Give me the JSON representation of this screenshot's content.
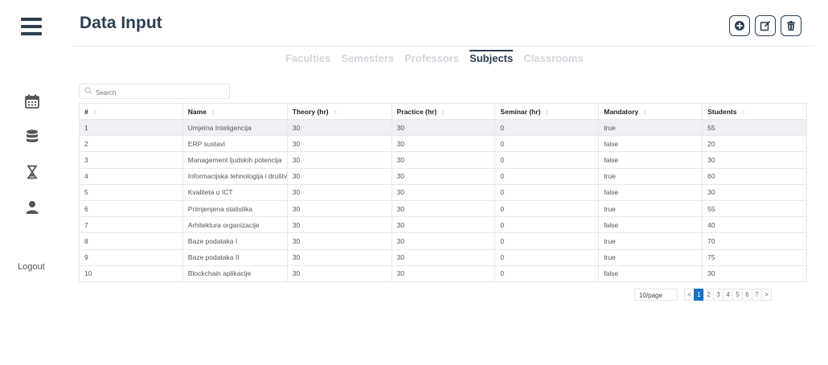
{
  "page": {
    "title": "Data Input"
  },
  "sidebar": {
    "items": [
      {
        "icon": "calendar-icon"
      },
      {
        "icon": "database-icon"
      },
      {
        "icon": "hourglass-icon"
      },
      {
        "icon": "user-icon"
      }
    ],
    "logout_label": "Logout"
  },
  "actions": [
    "add-icon",
    "edit-icon",
    "delete-icon"
  ],
  "tabs": [
    {
      "label": "Faculties",
      "active": false
    },
    {
      "label": "Semesters",
      "active": false
    },
    {
      "label": "Professors",
      "active": false
    },
    {
      "label": "Subjects",
      "active": true
    },
    {
      "label": "Classrooms",
      "active": false
    }
  ],
  "search": {
    "placeholder": "Search"
  },
  "table": {
    "columns": [
      "#",
      "Name",
      "Theory (hr)",
      "Practice (hr)",
      "Seminar (hr)",
      "Mandatory",
      "Students"
    ],
    "rows": [
      [
        "1",
        "Umjetna Inteligencija",
        "30",
        "30",
        "0",
        "true",
        "55"
      ],
      [
        "2",
        "ERP sustavi",
        "30",
        "30",
        "0",
        "false",
        "20"
      ],
      [
        "3",
        "Management ljudskih potencija",
        "30",
        "30",
        "0",
        "false",
        "30"
      ],
      [
        "4",
        "Informacijska tehnologija i društvo",
        "30",
        "30",
        "0",
        "true",
        "60"
      ],
      [
        "5",
        "Kvaliteta u ICT",
        "30",
        "30",
        "0",
        "false",
        "30"
      ],
      [
        "6",
        "Primjenjena statistika",
        "30",
        "30",
        "0",
        "true",
        "55"
      ],
      [
        "7",
        "Arhitektura organizacije",
        "30",
        "30",
        "0",
        "false",
        "40"
      ],
      [
        "8",
        "Baze podataka I",
        "30",
        "30",
        "0",
        "true",
        "70"
      ],
      [
        "9",
        "Baze podataka II",
        "30",
        "30",
        "0",
        "true",
        "75"
      ],
      [
        "10",
        "Blockchain aplikacije",
        "30",
        "30",
        "0",
        "false",
        "30"
      ]
    ],
    "highlighted_row": 1
  },
  "pagination": {
    "page_size_label": "10/page",
    "prev": "<",
    "next": ">",
    "pages": [
      "1",
      "2",
      "3",
      "4",
      "5",
      "6",
      "7"
    ],
    "current": "1"
  },
  "colors": {
    "primary": "#2c3e50",
    "accent": "#1a73c8",
    "muted_tab": "#d3d6db"
  }
}
